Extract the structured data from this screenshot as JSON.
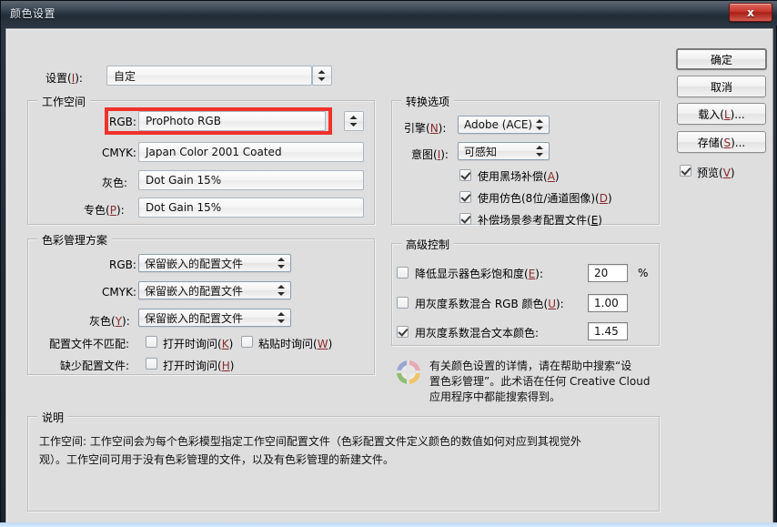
{
  "window": {
    "title": "颜色设置",
    "close_label": "x"
  },
  "settings_row": {
    "label": "设置(I):",
    "label_plain": "设置",
    "mnemonic": "I",
    "value": "自定"
  },
  "working_spaces": {
    "title": "工作空间",
    "rows": [
      {
        "label": "RGB:",
        "value": "ProPhoto RGB"
      },
      {
        "label": "CMYK:",
        "value": "Japan Color 2001 Coated"
      },
      {
        "label": "灰色:",
        "value": "Dot Gain 15%"
      },
      {
        "label": "专色(P):",
        "value": "Dot Gain 15%"
      }
    ]
  },
  "color_management_policies": {
    "title": "色彩管理方案",
    "rows": [
      {
        "label": "RGB:",
        "value": "保留嵌入的配置文件"
      },
      {
        "label": "CMYK:",
        "value": "保留嵌入的配置文件"
      },
      {
        "label": "灰色(Y):",
        "value": "保留嵌入的配置文件"
      }
    ],
    "mismatch_label": "配置文件不匹配:",
    "mismatch_options": [
      {
        "label": "打开时询问(K)",
        "checked": false
      },
      {
        "label": "粘贴时询问(W)",
        "checked": false
      }
    ],
    "missing_label": "缺少配置文件:",
    "missing_options": [
      {
        "label": "打开时询问(H)",
        "checked": false
      }
    ]
  },
  "conversion_options": {
    "title": "转换选项",
    "engine_label": "引擎(N):",
    "engine_value": "Adobe (ACE)",
    "intent_label": "意图(I):",
    "intent_value": "可感知",
    "checks": [
      {
        "label": "使用黑场补偿(A)",
        "checked": true
      },
      {
        "label": "使用仿色(8位/通道图像)(D)",
        "checked": true
      },
      {
        "label": "补偿场景参考配置文件(E)",
        "checked": true
      }
    ]
  },
  "advanced_controls": {
    "title": "高级控制",
    "rows": [
      {
        "label": "降低显示器色彩饱和度(E):",
        "checked": false,
        "value": "20",
        "suffix": "%"
      },
      {
        "label": "用灰度系数混合 RGB 颜色(U):",
        "checked": false,
        "value": "1.00",
        "suffix": ""
      },
      {
        "label": "用灰度系数混合文本颜色:",
        "checked": true,
        "value": "1.45",
        "suffix": ""
      }
    ]
  },
  "help": {
    "line1": "有关颜色设置的详情，请在帮助中搜索“设",
    "line2": "置色彩管理”。此术语在任何 Creative Cloud",
    "line3": "应用程序中都能搜索得到。",
    "icon": "color-wheel-icon"
  },
  "description": {
    "title": "说明",
    "line1": "工作空间: 工作空间会为每个色彩模型指定工作空间配置文件（色彩配置文件定义颜色的数值如何对应到其视觉外",
    "line2": "观）。工作空间可用于没有色彩管理的文件，以及有色彩管理的新建文件。"
  },
  "buttons": {
    "ok": "确定",
    "cancel": "取消",
    "load": "载入(L)...",
    "save": "存储(S)...",
    "preview_label": "预览(V)",
    "preview_checked": true
  },
  "annotation": {
    "highlight_color": "#f0312a",
    "target": "rgb-working-space-combo"
  }
}
